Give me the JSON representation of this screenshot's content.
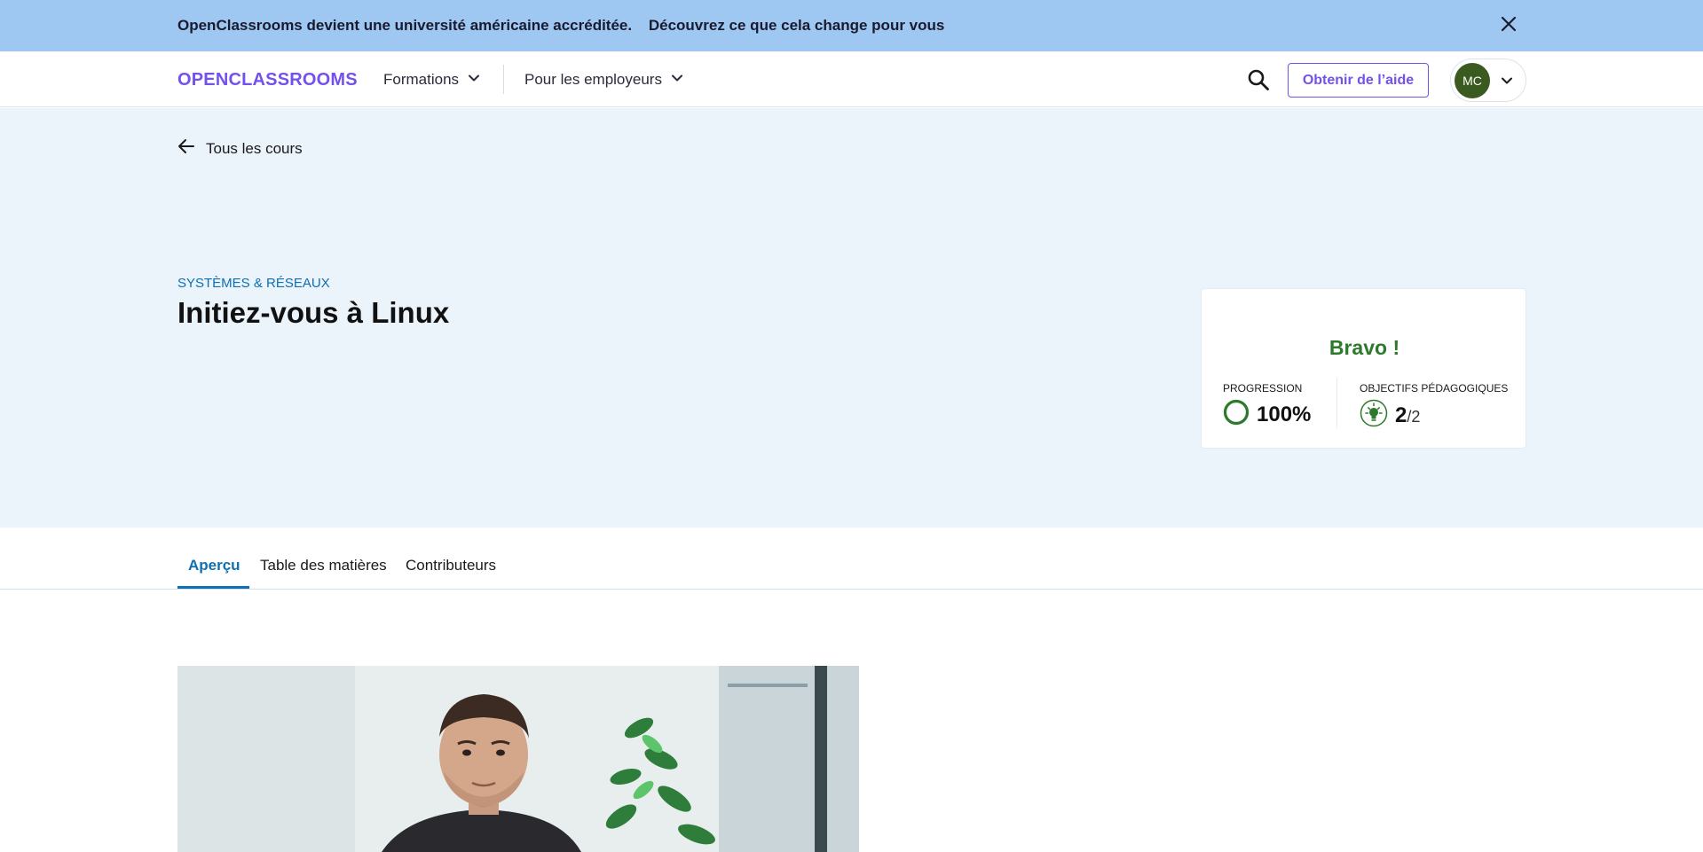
{
  "banner": {
    "text": "OpenClassrooms devient une université américaine accréditée.",
    "link": "Découvrez ce que cela change pour vous",
    "close_icon": "close-icon"
  },
  "header": {
    "logo": "OPENCLASSROOMS",
    "nav": {
      "formations": "Formations",
      "employeurs": "Pour les employeurs"
    },
    "search_icon": "search-icon",
    "help_button": "Obtenir de l’aide",
    "avatar_initials": "MC"
  },
  "hero": {
    "back_link": "Tous les cours",
    "category": "SYSTÈMES & RÉSEAUX",
    "title": "Initiez-vous à Linux"
  },
  "progress_card": {
    "bravo": "Bravo !",
    "progression_label": "PROGRESSION",
    "progression_value": "100%",
    "progression_fraction": 1.0,
    "objectives_label": "OBJECTIFS PÉDAGOGIQUES",
    "objectives_done": "2",
    "objectives_total": "/2"
  },
  "tabs": [
    {
      "label": "Aperçu",
      "active": true
    },
    {
      "label": "Table des matières",
      "active": false
    },
    {
      "label": "Contributeurs",
      "active": false
    }
  ],
  "colors": {
    "banner_bg": "#9ec8f2",
    "brand_purple": "#7451eb",
    "hero_bg": "#ebf3fb",
    "success_green": "#2d7a2d",
    "tab_active_blue": "#0f6fb0",
    "avatar_bg": "#3a5a1f"
  }
}
